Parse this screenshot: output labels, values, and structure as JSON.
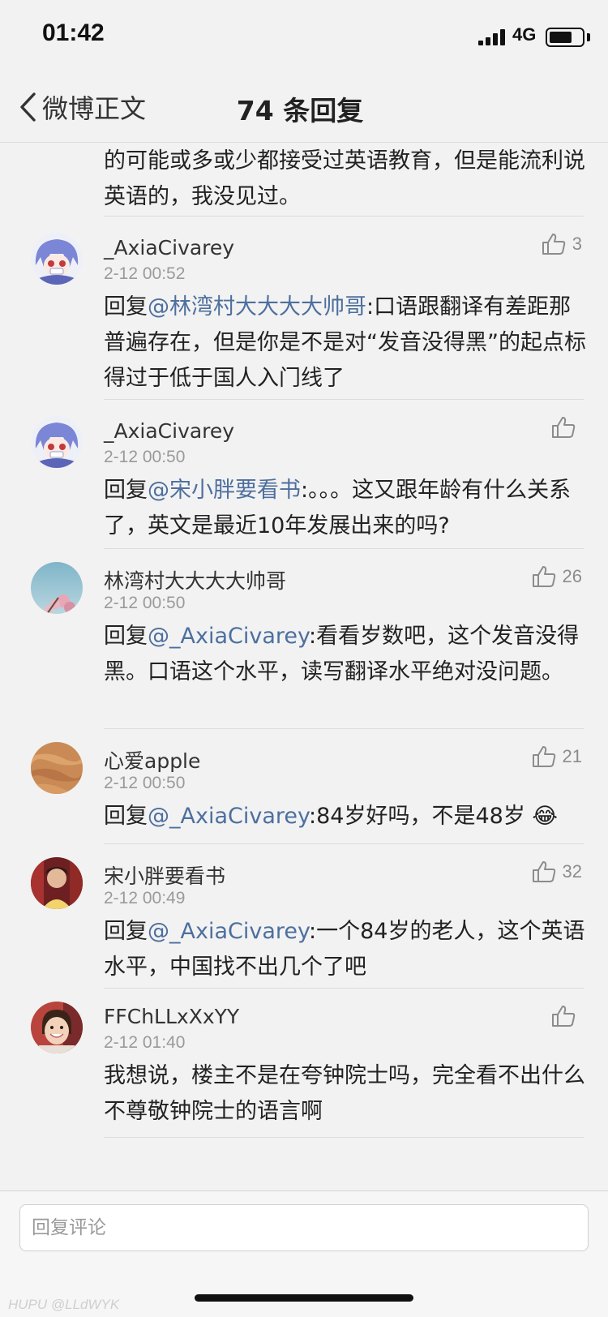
{
  "status_bar": {
    "time": "01:42",
    "network": "4G",
    "battery_level": 0.7
  },
  "nav": {
    "back_label": "微博正文",
    "title": "74 条回复"
  },
  "top_fragment": {
    "text": "的可能或多或少都接受过英语教育，但是能流利说英语的，我没见过。"
  },
  "comments": [
    {
      "name": "_AxiaCivarey",
      "time": "2-12 00:52",
      "likes": "3",
      "reply_prefix": "回复",
      "mention": "@林湾村大大大大帅哥",
      "text": ":口语跟翻译有差距那普遍存在，但是你是不是对“发音没得黑”的起点标得过于低于国人入门线了",
      "avatar": "anime-blue-hair"
    },
    {
      "name": "_AxiaCivarey",
      "time": "2-12 00:50",
      "likes": "",
      "reply_prefix": "回复",
      "mention": "@宋小胖要看书",
      "text": ":。。。这又跟年龄有什么关系了，英文是最近10年发展出来的吗?",
      "avatar": "anime-blue-hair"
    },
    {
      "name": "林湾村大大大大帅哥",
      "time": "2-12 00:50",
      "likes": "26",
      "reply_prefix": "回复",
      "mention": "@_AxiaCivarey",
      "text": ":看看岁数吧，这个发音没得黑。口语这个水平，读写翻译水平绝对没问题。",
      "avatar": "sky-blossom"
    },
    {
      "name": "心爱apple",
      "time": "2-12 00:50",
      "likes": "21",
      "reply_prefix": "回复",
      "mention": "@_AxiaCivarey",
      "text": ":84岁好吗，不是48岁",
      "emoji": "😂",
      "avatar": "desert-dunes"
    },
    {
      "name": "宋小胖要看书",
      "time": "2-12 00:49",
      "likes": "32",
      "reply_prefix": "回复",
      "mention": "@_AxiaCivarey",
      "text": ":一个84岁的老人，这个英语水平，中国找不出几个了吧",
      "avatar": "person-red"
    },
    {
      "name": "FFChLLxXxYY",
      "time": "2-12 01:40",
      "likes": "",
      "reply_prefix": "",
      "mention": "",
      "text": "我想说，楼主不是在夸钟院士吗，完全看不出什么不尊敬钟院士的语言啊",
      "avatar": "child-photo"
    }
  ],
  "reply_input": {
    "placeholder": "回复评论"
  },
  "watermark": "HUPU @LLdWYK",
  "icons": {
    "back": "chevron-left-icon",
    "like": "thumbs-up-icon"
  },
  "colors": {
    "mention": "#4d6f9e",
    "background": "#f2f2f2"
  }
}
